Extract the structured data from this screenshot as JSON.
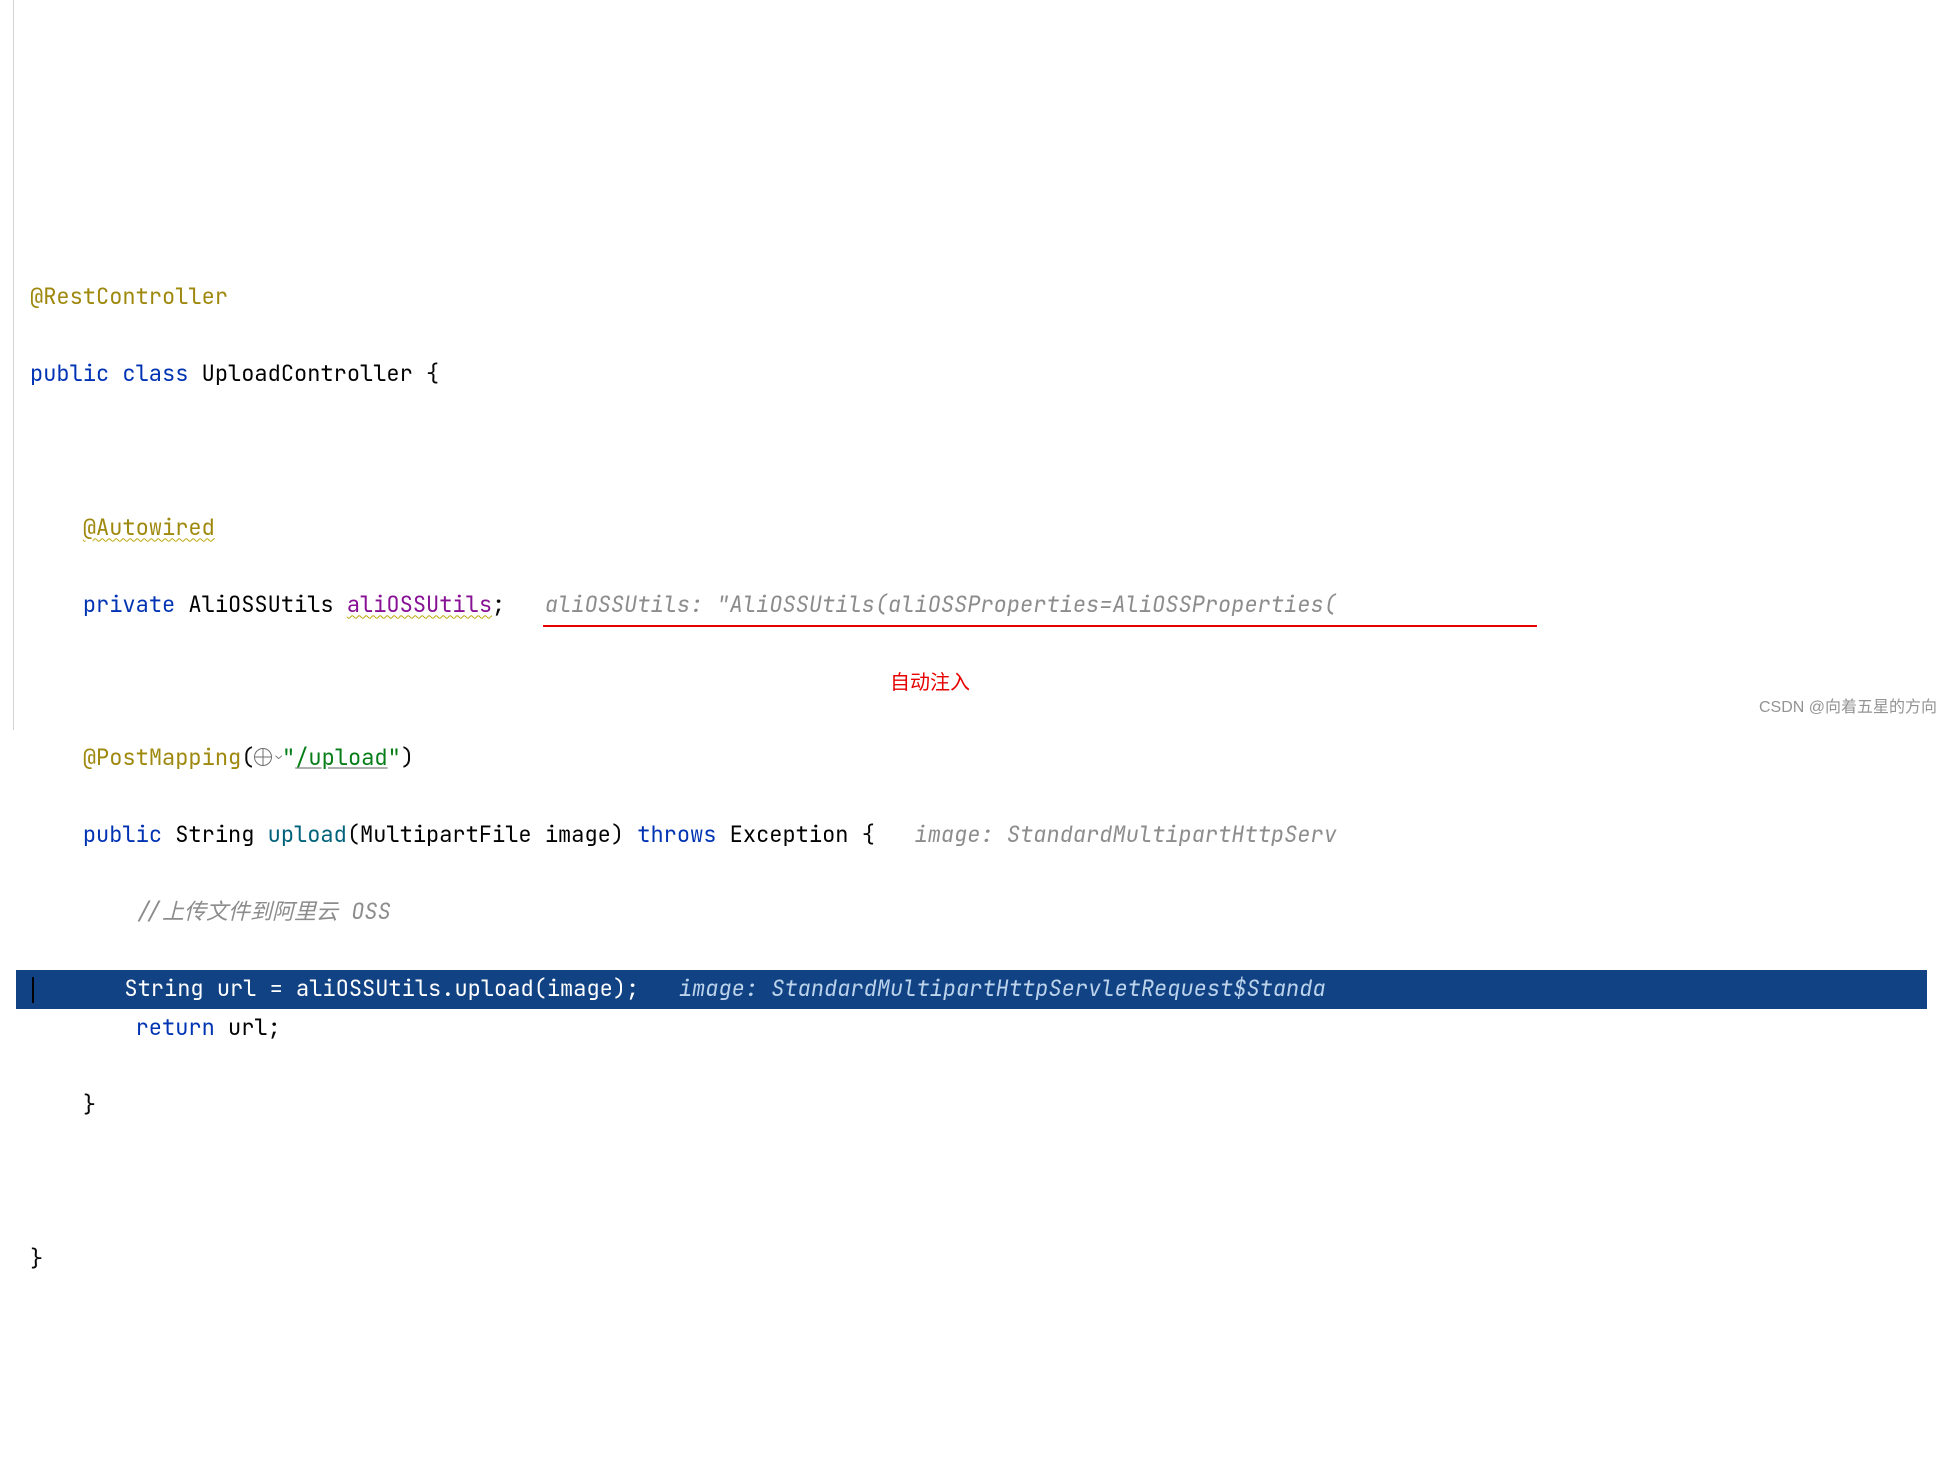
{
  "code": {
    "annotation_restcontroller": "@RestController",
    "kw_public": "public",
    "kw_class": "class",
    "class_name": "UploadController",
    "brace_open": "{",
    "annotation_autowired": "@Autowired",
    "kw_private": "private",
    "type_aliossutils": "AliOSSUtils",
    "field_aliossutils": "aliOSSUtils",
    "semicolon": ";",
    "hint_aliossutils": "aliOSSUtils: \"AliOSSUtils(aliOSSProperties=AliOSSProperties(",
    "annotation_red_label": "自动注入",
    "annotation_postmapping": "@PostMapping",
    "paren_open": "(",
    "paren_close": ")",
    "string_upload_path": "\"",
    "string_upload_path_text": "/upload",
    "string_upload_path_end": "\"",
    "kw_public2": "public",
    "type_string": "String",
    "method_upload": "upload",
    "type_multipartfile": "MultipartFile",
    "param_image": "image",
    "kw_throws": "throws",
    "type_exception": "Exception",
    "hint_image1": "image: StandardMultipartHttpServ",
    "comment_upload": "//上传文件到阿里云 OSS",
    "selected_line_text_pre": "String url = aliOSSUtils.upload(image);",
    "selected_type_string": "String",
    "selected_var_url": "url",
    "selected_eq": " = ",
    "selected_field": "aliOSSUtils",
    "selected_dot": ".",
    "selected_method": "upload",
    "selected_args": "(image);",
    "hint_image2": "image: StandardMultipartHttpServletRequest$Standa",
    "kw_return": "return",
    "var_url": "url",
    "brace_close_inner": "}",
    "brace_close_outer": "}"
  },
  "watermark": "CSDN @向着五星的方向"
}
